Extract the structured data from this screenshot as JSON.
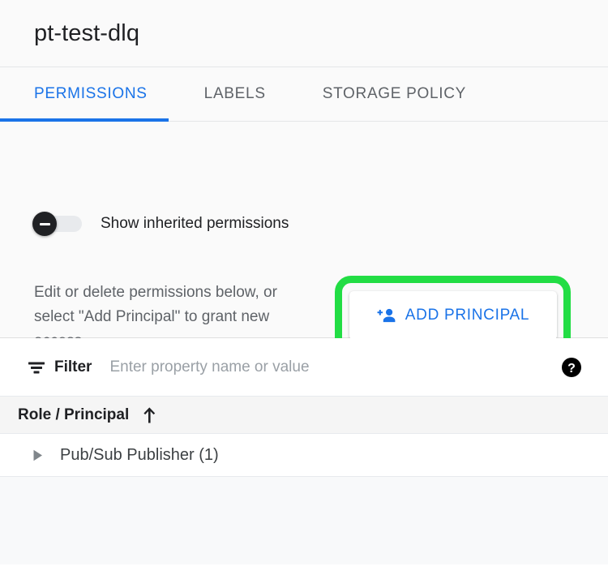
{
  "header": {
    "title": "pt-test-dlq"
  },
  "tabs": [
    {
      "label": "PERMISSIONS",
      "active": true
    },
    {
      "label": "LABELS",
      "active": false
    },
    {
      "label": "STORAGE POLICY",
      "active": false
    }
  ],
  "info": {
    "description": "Edit or delete permissions below, or select \"Add Principal\" to grant new access.",
    "toggle": {
      "label": "Show inherited permissions",
      "state": "off",
      "icon": "minus-icon"
    },
    "add_principal": {
      "label": "ADD PRINCIPAL",
      "icon": "person-add-icon",
      "highlight_color": "#22dd44",
      "text_color": "#1a73e8"
    }
  },
  "filter": {
    "icon": "filter-list-icon",
    "label": "Filter",
    "placeholder": "Enter property name or value",
    "value": "",
    "help_icon": "help-circle-icon"
  },
  "table": {
    "columns": [
      {
        "label": "Role / Principal",
        "sort": "ascending",
        "sort_icon": "arrow-up-icon"
      }
    ],
    "rows": [
      {
        "label": "Pub/Sub Publisher (1)",
        "expanded": false,
        "expander_icon": "triangle-right-icon"
      }
    ]
  },
  "colors": {
    "accent": "#1a73e8",
    "highlight": "#22dd44",
    "header_bg": "#fafafa",
    "text_primary": "#202124",
    "text_secondary": "#5f6368"
  }
}
